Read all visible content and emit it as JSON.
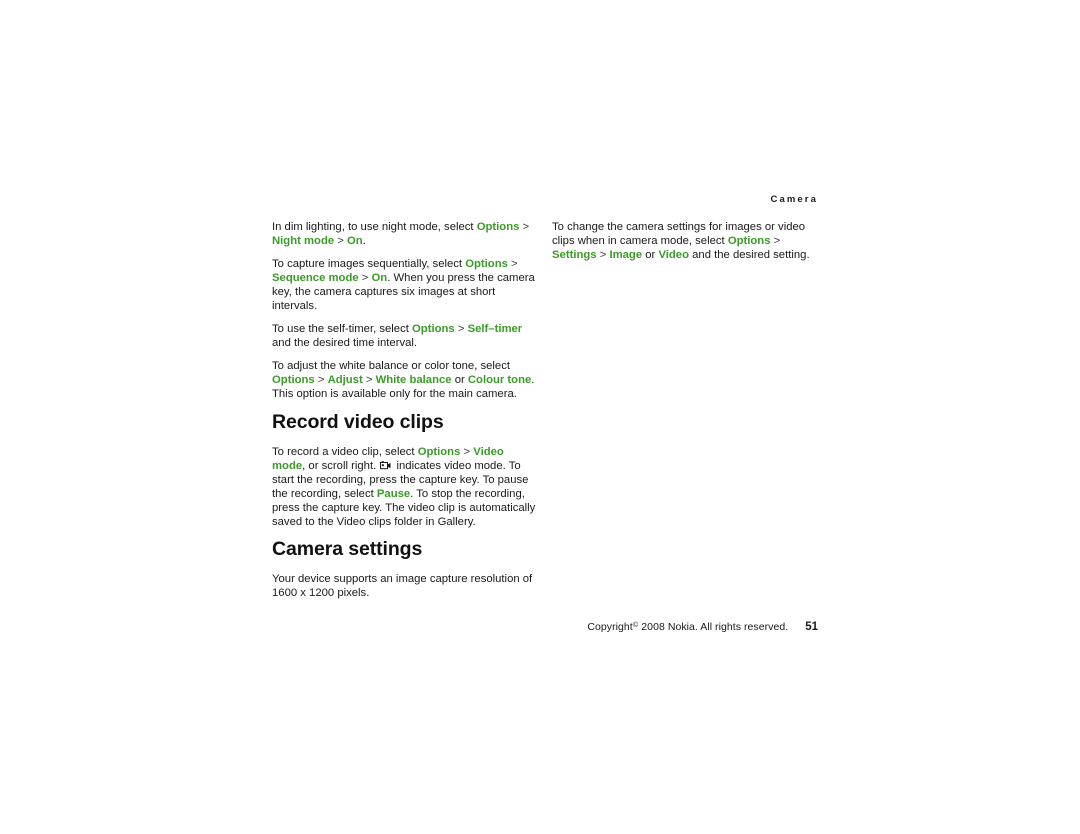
{
  "document": {
    "running_head": "Camera",
    "page_number": "51",
    "copyright": "Copyright © 2008 Nokia. All rights reserved.",
    "copyright_prefix": "Copyright",
    "copyright_symbol": "©",
    "copyright_rest": "2008 Nokia. All rights reserved."
  },
  "left_column": {
    "paragraphs": [
      {
        "id": "night-mode",
        "parts": [
          {
            "t": "In dim lighting, to use night mode, select ",
            "s": "plain"
          },
          {
            "t": "Options",
            "s": "ui"
          },
          {
            "t": " > ",
            "s": "sep"
          },
          {
            "t": "Night mode",
            "s": "ui"
          },
          {
            "t": " > ",
            "s": "sep"
          },
          {
            "t": "On",
            "s": "ui"
          },
          {
            "t": ".",
            "s": "plain"
          }
        ]
      },
      {
        "id": "sequence-mode",
        "parts": [
          {
            "t": "To capture images sequentially, select ",
            "s": "plain"
          },
          {
            "t": "Options",
            "s": "ui"
          },
          {
            "t": " > ",
            "s": "sep"
          },
          {
            "t": "Sequence mode",
            "s": "ui"
          },
          {
            "t": " > ",
            "s": "sep"
          },
          {
            "t": "On",
            "s": "ui"
          },
          {
            "t": ". When you press the camera key, the camera captures six images at short intervals.",
            "s": "plain"
          }
        ]
      },
      {
        "id": "self-timer",
        "parts": [
          {
            "t": "To use the self-timer, select ",
            "s": "plain"
          },
          {
            "t": "Options",
            "s": "ui"
          },
          {
            "t": " > ",
            "s": "sep"
          },
          {
            "t": "Self–timer",
            "s": "ui"
          },
          {
            "t": " and the desired time interval.",
            "s": "plain"
          }
        ]
      },
      {
        "id": "white-balance",
        "parts": [
          {
            "t": "To adjust the white balance or color tone, select ",
            "s": "plain"
          },
          {
            "t": "Options",
            "s": "ui"
          },
          {
            "t": " > ",
            "s": "sep"
          },
          {
            "t": "Adjust",
            "s": "ui"
          },
          {
            "t": " > ",
            "s": "sep"
          },
          {
            "t": "White balance",
            "s": "ui"
          },
          {
            "t": " or ",
            "s": "plain"
          },
          {
            "t": "Colour tone",
            "s": "ui"
          },
          {
            "t": ". This option is available only for the main camera.",
            "s": "plain"
          }
        ]
      }
    ],
    "heading_record": "Record video clips",
    "record_paragraph": {
      "id": "record-video",
      "parts": [
        {
          "t": "To record a video clip, select ",
          "s": "plain"
        },
        {
          "t": "Options",
          "s": "ui"
        },
        {
          "t": " > ",
          "s": "sep"
        },
        {
          "t": "Video mode",
          "s": "ui"
        },
        {
          "t": ", or scroll right. ",
          "s": "plain"
        },
        {
          "t": "",
          "s": "icon",
          "icon": "video-mode-icon"
        },
        {
          "t": " indicates video mode. To start the recording, press the capture key. To pause the recording, select ",
          "s": "plain"
        },
        {
          "t": "Pause",
          "s": "ui"
        },
        {
          "t": ". To stop the recording, press the capture key. The video clip is automatically saved to the Video clips folder in Gallery.",
          "s": "plain"
        }
      ]
    },
    "heading_settings": "Camera settings",
    "settings_paragraph": {
      "id": "capture-resolution",
      "parts": [
        {
          "t": "Your device supports an image capture resolution of 1600 x 1200 pixels.",
          "s": "plain"
        }
      ]
    }
  },
  "right_column": {
    "paragraphs": [
      {
        "id": "camera-settings-path",
        "parts": [
          {
            "t": "To change the camera settings for images or video clips when in camera mode, select ",
            "s": "plain"
          },
          {
            "t": "Options",
            "s": "ui"
          },
          {
            "t": " > ",
            "s": "sep"
          },
          {
            "t": "Settings",
            "s": "ui"
          },
          {
            "t": " > ",
            "s": "sep"
          },
          {
            "t": "Image",
            "s": "ui"
          },
          {
            "t": " or ",
            "s": "plain"
          },
          {
            "t": "Video",
            "s": "ui"
          },
          {
            "t": " and the desired setting.",
            "s": "plain"
          }
        ]
      }
    ]
  },
  "colors": {
    "ui_term_green": "#3a9c28",
    "body_text": "#1a1a1a",
    "page_background": "#ffffff"
  }
}
